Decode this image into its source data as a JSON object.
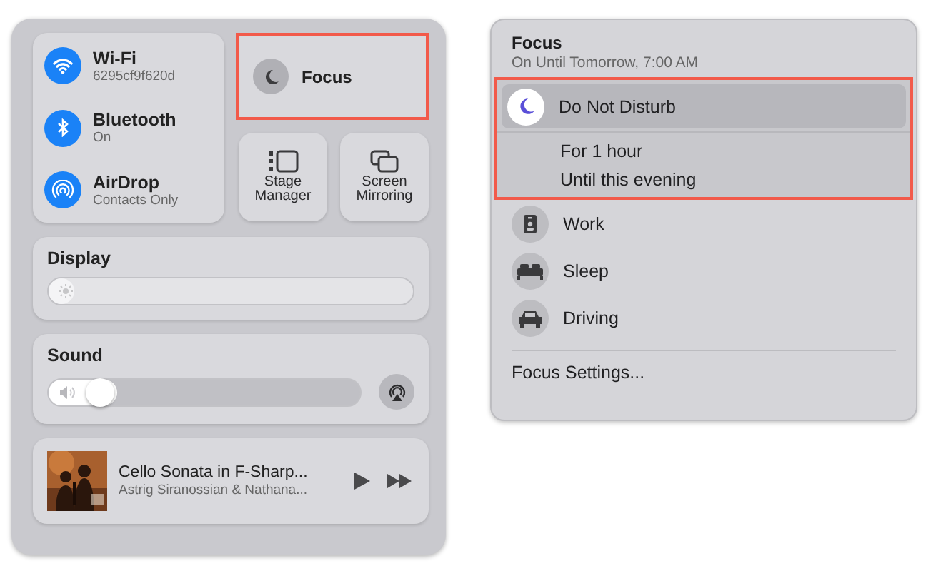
{
  "control_center": {
    "connectivity": [
      {
        "kind": "wifi",
        "title": "Wi-Fi",
        "subtitle": "6295cf9f620d",
        "on": true
      },
      {
        "kind": "bluetooth",
        "title": "Bluetooth",
        "subtitle": "On",
        "on": true
      },
      {
        "kind": "airdrop",
        "title": "AirDrop",
        "subtitle": "Contacts Only",
        "on": true
      }
    ],
    "focus_tile": {
      "label": "Focus",
      "highlighted": true
    },
    "tiles": [
      {
        "kind": "stage",
        "label": "Stage Manager"
      },
      {
        "kind": "mirror",
        "label": "Screen Mirroring"
      }
    ],
    "display": {
      "title": "Display",
      "level": 0
    },
    "sound": {
      "title": "Sound",
      "level": 0.17
    },
    "now_playing": {
      "kind": "picture",
      "title": "Cello Sonata in F-Sharp...",
      "artist": "Astrig Siranossian & Nathana..."
    }
  },
  "focus_menu": {
    "title": "Focus",
    "subtitle": "On Until Tomorrow, 7:00 AM",
    "highlighted": true,
    "active_mode": {
      "label": "Do Not Disturb",
      "selected": true,
      "options": [
        "For 1 hour",
        "Until this evening"
      ]
    },
    "modes": [
      {
        "kind": "work",
        "label": "Work",
        "selected": false
      },
      {
        "kind": "sleep",
        "label": "Sleep",
        "selected": false
      },
      {
        "kind": "driving",
        "label": "Driving",
        "selected": false
      }
    ],
    "settings": "Focus Settings..."
  }
}
